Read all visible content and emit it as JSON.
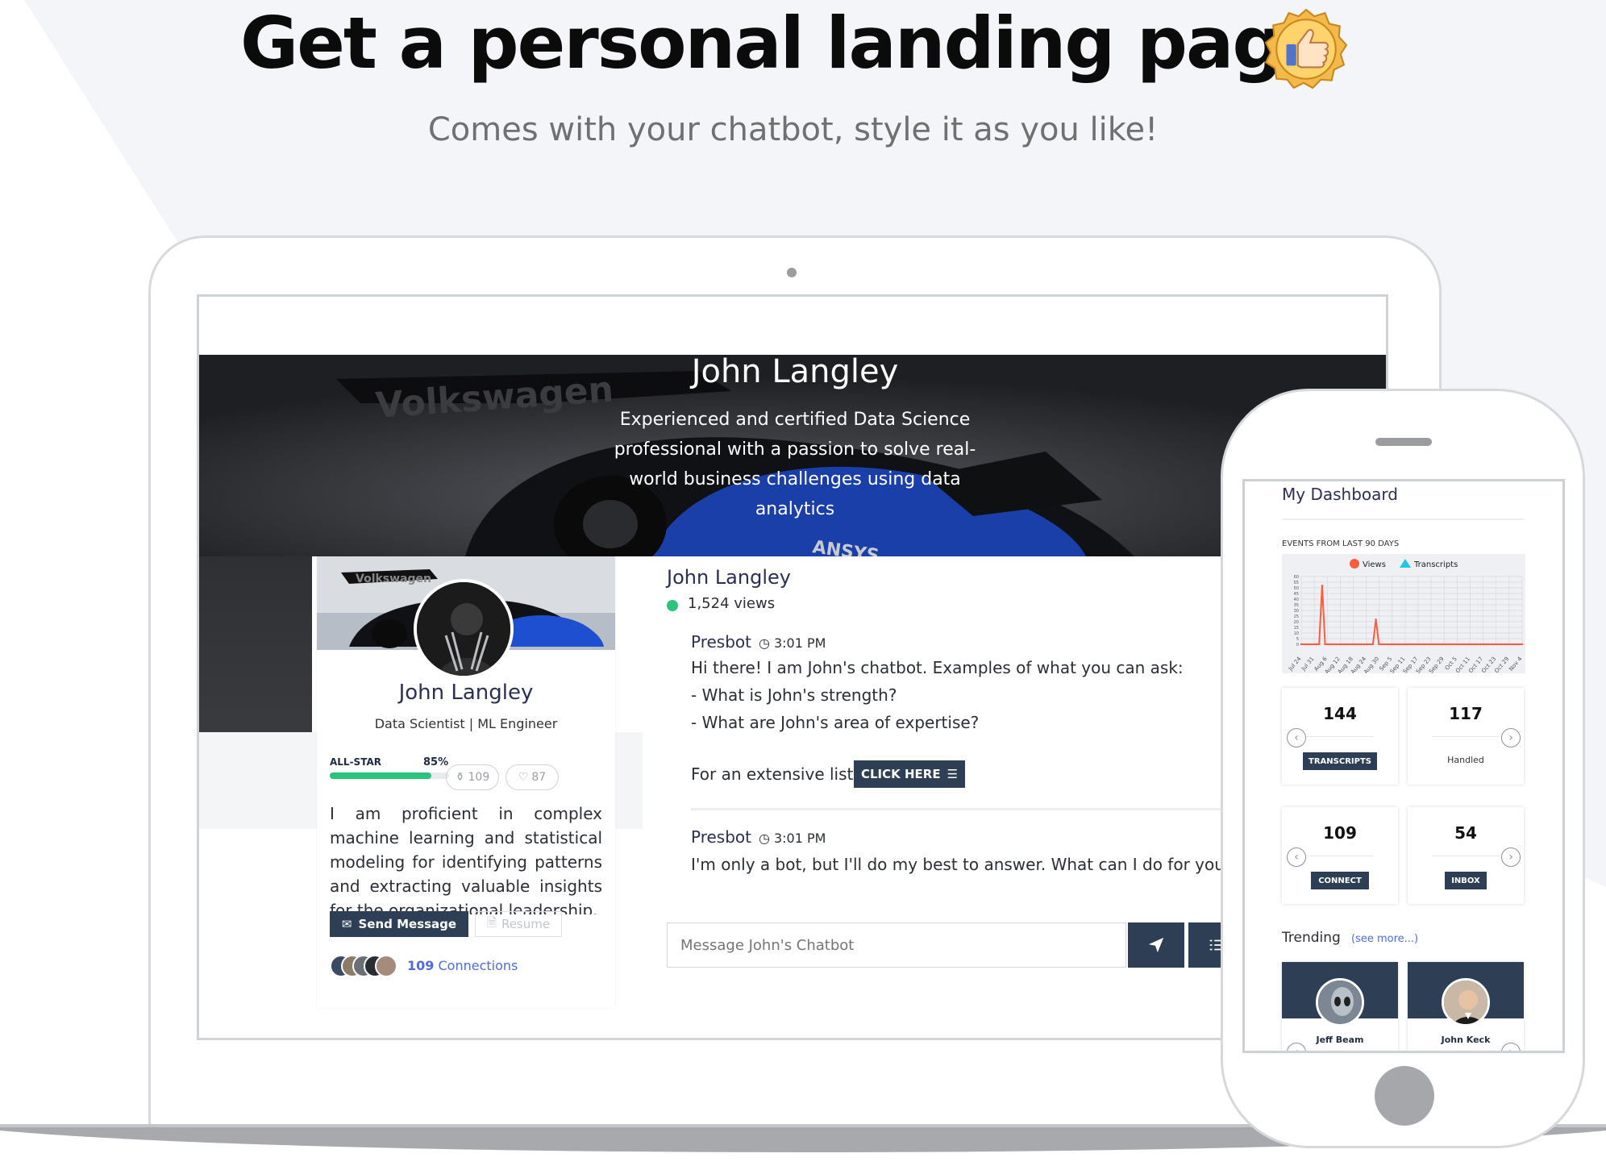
{
  "headline": "Get a personal landing page",
  "subheadline": "Comes with your chatbot, style it as you like!",
  "hero": {
    "name": "John Langley",
    "description": "Experienced and certified Data Science professional with a passion to solve real-world business challenges using data analytics"
  },
  "profile_card": {
    "name": "John Langley",
    "role": "Data Scientist | ML Engineer",
    "level_label": "ALL-STAR",
    "progress_label": "85%",
    "progress": 0.85,
    "endorsements": "109",
    "likes": "87",
    "bio": "I am proficient in complex machine learning and statistical modeling for identifying patterns and extracting valuable insights for the organizational leadership.",
    "send_message_label": "Send Message",
    "resume_label": "Resume",
    "connections_count": "109",
    "connections_label": "Connections"
  },
  "chat": {
    "name": "John Langley",
    "views": "1,524 views",
    "messages": [
      {
        "sender": "Presbot",
        "time": "3:01 PM",
        "lines": [
          "Hi there! I am John's chatbot. Examples of what you can ask:",
          "- What is John's strength?",
          "- What are John's area of expertise?"
        ],
        "cta_text": "For an extensive list,",
        "cta_button": "CLICK HERE"
      },
      {
        "sender": "Presbot",
        "time": "3:01 PM",
        "lines": [
          "I'm only a bot, but I'll do my best to answer. What can I do for you"
        ]
      }
    ],
    "input_placeholder": "Message John's Chatbot"
  },
  "dashboard": {
    "title": "My Dashboard",
    "events_label": "EVENTS FROM LAST 90 DAYS",
    "stats": [
      {
        "value": "144",
        "label": "TRANSCRIPTS"
      },
      {
        "value": "117",
        "label": "Handled"
      },
      {
        "value": "109",
        "label": "CONNECT"
      },
      {
        "value": "54",
        "label": "INBOX"
      }
    ],
    "trending_label": "Trending",
    "see_more_label": "(see more...)",
    "trending_people": [
      "Jeff Beam",
      "John Keck"
    ]
  },
  "chart_data": {
    "type": "line",
    "title": "",
    "series": [
      {
        "name": "Views",
        "color": "#ff5a3c",
        "values": [
          0,
          0,
          0,
          0,
          0,
          0,
          0,
          52,
          0,
          0,
          0,
          0,
          0,
          0,
          0,
          0,
          0,
          0,
          0,
          0,
          0,
          0,
          0,
          0,
          0,
          22,
          0,
          0,
          0,
          0,
          0,
          0,
          0,
          0,
          0,
          0,
          0,
          0,
          0,
          0,
          0,
          0,
          0,
          0,
          0,
          0,
          0,
          0,
          0,
          0,
          0,
          0,
          0,
          0,
          0,
          0,
          0,
          0,
          0,
          0,
          0,
          0,
          0,
          0,
          0,
          0,
          0,
          0,
          0,
          0,
          0,
          0,
          0,
          0,
          0
        ]
      },
      {
        "name": "Transcripts",
        "color": "#1ec8e6",
        "values": []
      }
    ],
    "x_ticks": [
      "Jul 24",
      "Jul 31",
      "Aug 6",
      "Aug 12",
      "Aug 18",
      "Aug 24",
      "Aug 30",
      "Sep 5",
      "Sep 11",
      "Sep 17",
      "Sep 23",
      "Sep 29",
      "Oct 5",
      "Oct 11",
      "Oct 17",
      "Oct 23",
      "Oct 29",
      "Nov 4"
    ],
    "y_ticks": [
      "0",
      "5",
      "10",
      "15",
      "20",
      "25",
      "30",
      "35",
      "40",
      "45",
      "50",
      "55",
      "60"
    ],
    "ylim": [
      0,
      60
    ],
    "legend": "top-center",
    "grid": true
  },
  "colors": {
    "navy": "#2e3e55",
    "accent_green": "#2bc37c",
    "link_blue": "#4f6bdc",
    "views_line": "#ff5a3c",
    "transcripts_marker": "#1ec8e6"
  }
}
